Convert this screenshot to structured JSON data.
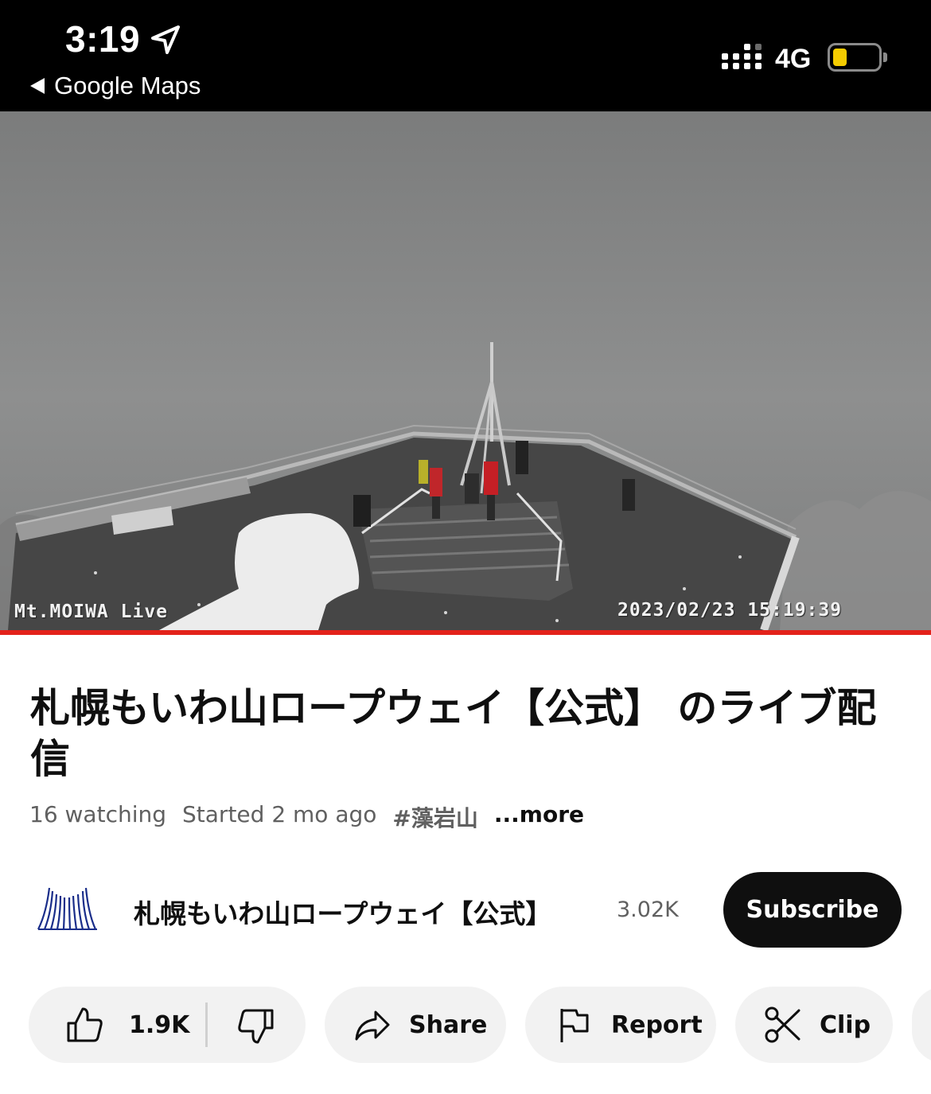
{
  "status_bar": {
    "time": "3:19",
    "back_label": "Google Maps",
    "network": "4G",
    "battery_level": 0.3,
    "battery_color": "#f5cc00"
  },
  "video": {
    "overlay_left": "Mt.MOIWA Live",
    "overlay_timestamp": "2023/02/23 15:19:39",
    "progress_fraction": 1.0,
    "progress_color": "#e3221b"
  },
  "title": "札幌もいわ山ロープウェイ【公式】 のライブ配信",
  "meta": {
    "watching": "16 watching",
    "started": "Started 2 mo ago",
    "hashtag": "#藻岩山",
    "more": "...more"
  },
  "channel": {
    "name": "札幌もいわ山ロープウェイ【公式】",
    "subscribers": "3.02K",
    "subscribe_label": "Subscribe",
    "logo_color": "#1a2e8a"
  },
  "actions": {
    "likes": "1.9K",
    "share": "Share",
    "report": "Report",
    "clip": "Clip"
  },
  "icons": {
    "like": "thumbs-up-icon",
    "dislike": "thumbs-down-icon",
    "share": "share-arrow-icon",
    "report": "flag-icon",
    "clip": "scissors-icon"
  }
}
